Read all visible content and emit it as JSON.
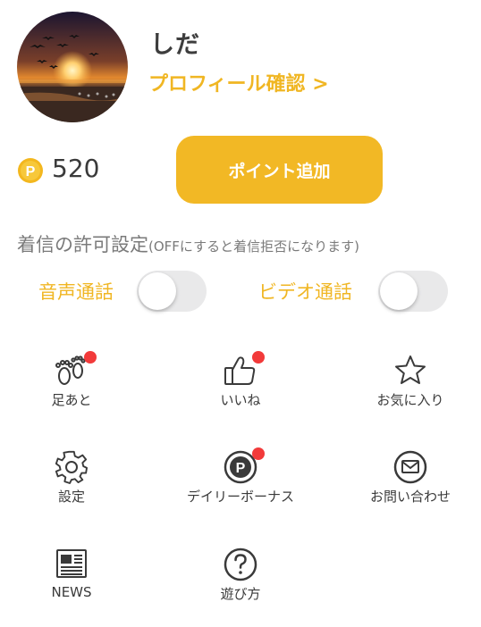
{
  "profile": {
    "username": "しだ",
    "profile_link": "プロフィール確認 >",
    "avatar_icon": "sunset-photo"
  },
  "points": {
    "value": "520",
    "coin_icon": "coin-icon",
    "add_button": "ポイント追加"
  },
  "call_settings": {
    "title": "着信の許可設定",
    "note": "(OFFにすると着信拒否になります)",
    "voice_label": "音声通話",
    "voice_enabled": false,
    "video_label": "ビデオ通話",
    "video_enabled": false
  },
  "menu": {
    "footprints": "足あと",
    "likes": "いいね",
    "favorites": "お気に入り",
    "settings": "設定",
    "daily_bonus": "デイリーボーナス",
    "contact": "お問い合わせ",
    "news": "NEWS",
    "how_to_play": "遊び方"
  },
  "colors": {
    "accent": "#f2b825",
    "badge": "#f23a3a",
    "toggle_off": "#e9e9ea"
  }
}
